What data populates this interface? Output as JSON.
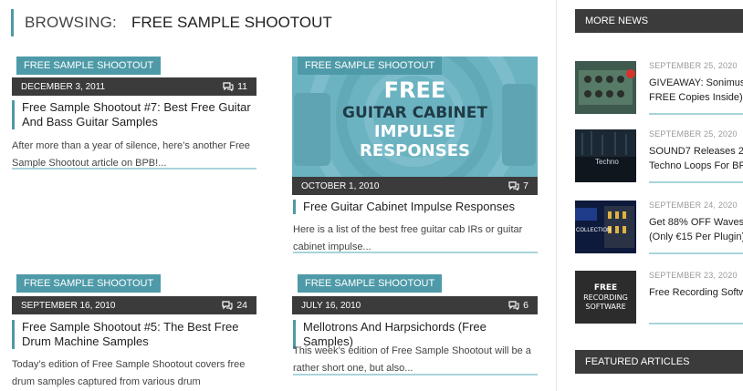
{
  "header": {
    "browsing_label": "BROWSING:",
    "category": "FREE SAMPLE SHOOTOUT"
  },
  "posts": [
    {
      "category": "FREE SAMPLE SHOOTOUT",
      "date": "DECEMBER 3, 2011",
      "comments": "11",
      "title": "Free Sample Shootout #7: Best Free Guitar And Bass Guitar Samples",
      "excerpt": "After more than a year of silence, here’s another Free Sample Shootout article on BPB!..."
    },
    {
      "category": "FREE SAMPLE SHOOTOUT",
      "date": "OCTOBER 1, 2010",
      "comments": "7",
      "title": "Free Guitar Cabinet Impulse Responses",
      "excerpt": "Here is a list of the best free guitar cab IRs or guitar cabinet impulse...",
      "thumb_lines": [
        "FREE",
        "GUITAR CABINET",
        "IMPULSE",
        "RESPONSES"
      ]
    },
    {
      "category": "FREE SAMPLE SHOOTOUT",
      "date": "SEPTEMBER 16, 2010",
      "comments": "24",
      "title": "Free Sample Shootout #5: The Best Free Drum Machine Samples",
      "excerpt": "Today’s edition of Free Sample Shootout covers free drum samples captured from various drum"
    },
    {
      "category": "FREE SAMPLE SHOOTOUT",
      "date": "JULY 16, 2010",
      "comments": "6",
      "title": "Mellotrons And Harpsichords (Free Samples)",
      "excerpt": "This week’s edition of Free Sample Shootout will be a rather short one, but also..."
    }
  ],
  "sidebar": {
    "more_news_label": "MORE NEWS",
    "featured_label": "FEATURED ARTICLES",
    "news": [
      {
        "date": "SEPTEMBER 25, 2020",
        "title": "GIVEAWAY: Sonimus\nFREE Copies Inside)"
      },
      {
        "date": "SEPTEMBER 25, 2020",
        "title": "SOUND7 Releases 20\nTechno Loops For BP",
        "thumb_text": "Techno"
      },
      {
        "date": "SEPTEMBER 24, 2020",
        "title": "Get 88% OFF Waves A\n(Only €15 Per Plugin)",
        "thumb_text": "COLLECTION"
      },
      {
        "date": "SEPTEMBER 23, 2020",
        "title": "Free Recording Softw",
        "thumb_lines": [
          "FREE",
          "RECORDING",
          "SOFTWARE"
        ]
      }
    ]
  },
  "colors": {
    "accent": "#4e9aa8",
    "dark_bar": "#3b3b3b",
    "underline": "#a9d3db"
  }
}
